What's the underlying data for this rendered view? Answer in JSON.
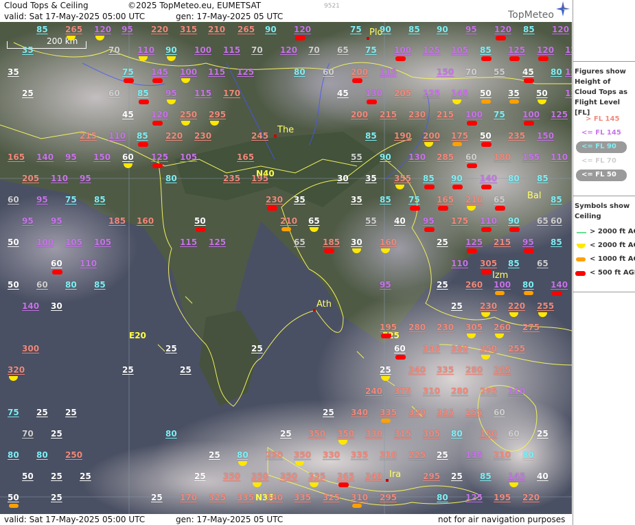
{
  "header": {
    "title": "Cloud Tops & Ceiling",
    "copyright": "©2025 TopMeteo.eu, EUMETSAT",
    "image_number": "9521",
    "valid": "valid:  Sat  17-May-2025  05:00 UTC",
    "generated": "gen: 17-May-2025 05 UTC",
    "logo": "TopMeteo"
  },
  "footer": {
    "valid": "valid:  Sat  17-May-2025  05:00 UTC",
    "generated": "gen: 17-May-2025 05 UTC",
    "disclaimer": "not for air navigation purposes"
  },
  "legend": {
    "tops_title": "Figures show Height of Cloud Tops as Flight Level  [FL]",
    "tops": [
      {
        "text": "> FL 145",
        "color": "#f08a7c"
      },
      {
        "text": "<= FL 145",
        "color": "#c874ea"
      },
      {
        "text": "<= FL 90",
        "color": "#7ff0f6"
      },
      {
        "text": "<= FL 70",
        "color": "#cfcfcf"
      },
      {
        "text": "<= FL 50",
        "color": "#ffffff"
      }
    ],
    "ceiling_title": "Symbols show Ceiling",
    "ceiling": [
      {
        "text": "> 2000 ft AGL",
        "symbol": "line-green"
      },
      {
        "text": "< 2000 ft AGL",
        "symbol": "half-yellow"
      },
      {
        "text": "< 1000 ft AGL",
        "symbol": "bar-orange"
      },
      {
        "text": "< 500 ft AGL",
        "symbol": "bar-red"
      }
    ]
  },
  "map": {
    "scale": "200 km",
    "cities": [
      {
        "name": "Plo"
      },
      {
        "name": "The"
      },
      {
        "name": "Ath"
      },
      {
        "name": "Izm"
      },
      {
        "name": "Bal"
      },
      {
        "name": "Ira"
      }
    ],
    "grid": [
      "N40",
      "E20",
      "E25",
      "N35"
    ]
  },
  "observations": [
    {
      "v": "85",
      "c": "c",
      "s": ""
    },
    {
      "v": "265",
      "c": "r",
      "s": "y"
    },
    {
      "v": "120",
      "c": "v",
      "s": "y"
    },
    {
      "v": "95",
      "c": "v",
      "s": ""
    },
    {
      "v": "220",
      "c": "r",
      "s": ""
    },
    {
      "v": "315",
      "c": "r",
      "s": ""
    },
    {
      "v": "210",
      "c": "r",
      "s": ""
    },
    {
      "v": "265",
      "c": "r",
      "s": ""
    },
    {
      "v": "90",
      "c": "c",
      "s": ""
    },
    {
      "v": "120",
      "c": "v",
      "s": "d"
    },
    {
      "v": "75",
      "c": "c",
      "s": ""
    },
    {
      "v": "90",
      "c": "c",
      "s": ""
    },
    {
      "v": "85",
      "c": "c",
      "s": ""
    },
    {
      "v": "90",
      "c": "c",
      "s": ""
    },
    {
      "v": "95",
      "c": "v",
      "s": ""
    },
    {
      "v": "120",
      "c": "v",
      "s": "d"
    },
    {
      "v": "85",
      "c": "c",
      "s": ""
    },
    {
      "v": "120",
      "c": "v",
      "s": ""
    },
    {
      "v": "35",
      "c": "c",
      "s": ""
    },
    {
      "v": "70",
      "c": "g",
      "s": ""
    },
    {
      "v": "110",
      "c": "v",
      "s": "y"
    },
    {
      "v": "90",
      "c": "c",
      "s": "y"
    },
    {
      "v": "100",
      "c": "v",
      "s": ""
    },
    {
      "v": "115",
      "c": "v",
      "s": ""
    },
    {
      "v": "70",
      "c": "g",
      "s": ""
    },
    {
      "v": "120",
      "c": "v",
      "s": ""
    },
    {
      "v": "70",
      "c": "g",
      "s": ""
    },
    {
      "v": "65",
      "c": "g",
      "s": ""
    },
    {
      "v": "75",
      "c": "c",
      "s": ""
    },
    {
      "v": "100",
      "c": "v",
      "s": "d"
    },
    {
      "v": "125",
      "c": "v",
      "s": ""
    },
    {
      "v": "105",
      "c": "v",
      "s": ""
    },
    {
      "v": "85",
      "c": "c",
      "s": "d"
    },
    {
      "v": "125",
      "c": "v",
      "s": "d"
    },
    {
      "v": "120",
      "c": "v",
      "s": "d"
    },
    {
      "v": "125",
      "c": "v",
      "s": ""
    },
    {
      "v": "35",
      "c": "w",
      "s": ""
    },
    {
      "v": "75",
      "c": "c",
      "s": "d"
    },
    {
      "v": "145",
      "c": "v",
      "s": "d"
    },
    {
      "v": "100",
      "c": "v",
      "s": "y"
    },
    {
      "v": "115",
      "c": "v",
      "s": ""
    },
    {
      "v": "125",
      "c": "v",
      "s": ""
    },
    {
      "v": "80",
      "c": "c",
      "s": ""
    },
    {
      "v": "60",
      "c": "g",
      "s": ""
    },
    {
      "v": "200",
      "c": "r",
      "s": "d"
    },
    {
      "v": "115",
      "c": "v",
      "s": ""
    },
    {
      "v": "150",
      "c": "v",
      "s": ""
    },
    {
      "v": "70",
      "c": "g",
      "s": ""
    },
    {
      "v": "55",
      "c": "g",
      "s": ""
    },
    {
      "v": "45",
      "c": "w",
      "s": "d"
    },
    {
      "v": "80",
      "c": "c",
      "s": ""
    },
    {
      "v": "120",
      "c": "v",
      "s": ""
    },
    {
      "v": "25",
      "c": "w",
      "s": ""
    },
    {
      "v": "60",
      "c": "g",
      "s": ""
    },
    {
      "v": "85",
      "c": "c",
      "s": "d"
    },
    {
      "v": "95",
      "c": "v",
      "s": "y"
    },
    {
      "v": "115",
      "c": "v",
      "s": ""
    },
    {
      "v": "170",
      "c": "r",
      "s": ""
    },
    {
      "v": "45",
      "c": "w",
      "s": ""
    },
    {
      "v": "130",
      "c": "v",
      "s": "d"
    },
    {
      "v": "205",
      "c": "r",
      "s": ""
    },
    {
      "v": "125",
      "c": "v",
      "s": ""
    },
    {
      "v": "145",
      "c": "v",
      "s": "y"
    },
    {
      "v": "50",
      "c": "w",
      "s": "o"
    },
    {
      "v": "35",
      "c": "w",
      "s": "o"
    },
    {
      "v": "50",
      "c": "w",
      "s": "y"
    },
    {
      "v": "120",
      "c": "v",
      "s": ""
    },
    {
      "v": "45",
      "c": "w",
      "s": ""
    },
    {
      "v": "120",
      "c": "v",
      "s": "d"
    },
    {
      "v": "250",
      "c": "r",
      "s": "y"
    },
    {
      "v": "295",
      "c": "r",
      "s": "y"
    },
    {
      "v": "200",
      "c": "r",
      "s": ""
    },
    {
      "v": "215",
      "c": "r",
      "s": ""
    },
    {
      "v": "230",
      "c": "r",
      "s": ""
    },
    {
      "v": "215",
      "c": "r",
      "s": ""
    },
    {
      "v": "100",
      "c": "v",
      "s": "d"
    },
    {
      "v": "75",
      "c": "c",
      "s": ""
    },
    {
      "v": "100",
      "c": "v",
      "s": "d"
    },
    {
      "v": "125",
      "c": "v",
      "s": ""
    },
    {
      "v": "215",
      "c": "r",
      "s": ""
    },
    {
      "v": "110",
      "c": "v",
      "s": ""
    },
    {
      "v": "85",
      "c": "c",
      "s": "d"
    },
    {
      "v": "220",
      "c": "r",
      "s": ""
    },
    {
      "v": "230",
      "c": "r",
      "s": ""
    },
    {
      "v": "245",
      "c": "r",
      "s": ""
    },
    {
      "v": "85",
      "c": "c",
      "s": ""
    },
    {
      "v": "190",
      "c": "r",
      "s": ""
    },
    {
      "v": "200",
      "c": "r",
      "s": "y"
    },
    {
      "v": "175",
      "c": "r",
      "s": "o"
    },
    {
      "v": "50",
      "c": "w",
      "s": "d"
    },
    {
      "v": "235",
      "c": "r",
      "s": ""
    },
    {
      "v": "150",
      "c": "v",
      "s": ""
    },
    {
      "v": "165",
      "c": "r",
      "s": ""
    },
    {
      "v": "140",
      "c": "v",
      "s": ""
    },
    {
      "v": "95",
      "c": "v",
      "s": ""
    },
    {
      "v": "150",
      "c": "v",
      "s": ""
    },
    {
      "v": "60",
      "c": "w",
      "s": "y"
    },
    {
      "v": "125",
      "c": "v",
      "s": "d"
    },
    {
      "v": "105",
      "c": "v",
      "s": ""
    },
    {
      "v": "165",
      "c": "r",
      "s": ""
    },
    {
      "v": "55",
      "c": "g",
      "s": ""
    },
    {
      "v": "90",
      "c": "c",
      "s": ""
    },
    {
      "v": "130",
      "c": "v",
      "s": ""
    },
    {
      "v": "285",
      "c": "r",
      "s": ""
    },
    {
      "v": "60",
      "c": "g",
      "s": "d"
    },
    {
      "v": "180",
      "c": "r",
      "s": ""
    },
    {
      "v": "155",
      "c": "v",
      "s": ""
    },
    {
      "v": "110",
      "c": "v",
      "s": ""
    },
    {
      "v": "205",
      "c": "r",
      "s": ""
    },
    {
      "v": "110",
      "c": "v",
      "s": ""
    },
    {
      "v": "95",
      "c": "v",
      "s": ""
    },
    {
      "v": "80",
      "c": "c",
      "s": ""
    },
    {
      "v": "235",
      "c": "r",
      "s": ""
    },
    {
      "v": "195",
      "c": "r",
      "s": ""
    },
    {
      "v": "30",
      "c": "w",
      "s": ""
    },
    {
      "v": "35",
      "c": "w",
      "s": ""
    },
    {
      "v": "355",
      "c": "r",
      "s": "y"
    },
    {
      "v": "85",
      "c": "c",
      "s": "d"
    },
    {
      "v": "90",
      "c": "c",
      "s": "d"
    },
    {
      "v": "140",
      "c": "v",
      "s": "d"
    },
    {
      "v": "80",
      "c": "c",
      "s": ""
    },
    {
      "v": "85",
      "c": "c",
      "s": ""
    },
    {
      "v": "60",
      "c": "g",
      "s": ""
    },
    {
      "v": "95",
      "c": "v",
      "s": ""
    },
    {
      "v": "75",
      "c": "c",
      "s": ""
    },
    {
      "v": "85",
      "c": "c",
      "s": ""
    },
    {
      "v": "230",
      "c": "r",
      "s": "d"
    },
    {
      "v": "35",
      "c": "w",
      "s": ""
    },
    {
      "v": "35",
      "c": "w",
      "s": ""
    },
    {
      "v": "85",
      "c": "c",
      "s": ""
    },
    {
      "v": "75",
      "c": "c",
      "s": "d"
    },
    {
      "v": "165",
      "c": "r",
      "s": "d"
    },
    {
      "v": "210",
      "c": "r",
      "s": "y"
    },
    {
      "v": "65",
      "c": "g",
      "s": "d"
    },
    {
      "v": "85",
      "c": "c",
      "s": ""
    },
    {
      "v": "95",
      "c": "v",
      "s": ""
    },
    {
      "v": "95",
      "c": "v",
      "s": ""
    },
    {
      "v": "185",
      "c": "r",
      "s": ""
    },
    {
      "v": "160",
      "c": "r",
      "s": ""
    },
    {
      "v": "50",
      "c": "w",
      "s": "d"
    },
    {
      "v": "210",
      "c": "r",
      "s": "o"
    },
    {
      "v": "65",
      "c": "w",
      "s": "y"
    },
    {
      "v": "55",
      "c": "g",
      "s": ""
    },
    {
      "v": "40",
      "c": "w",
      "s": ""
    },
    {
      "v": "95",
      "c": "v",
      "s": "d"
    },
    {
      "v": "175",
      "c": "r",
      "s": ""
    },
    {
      "v": "110",
      "c": "v",
      "s": "d"
    },
    {
      "v": "90",
      "c": "c",
      "s": "d"
    },
    {
      "v": "65",
      "c": "g",
      "s": ""
    },
    {
      "v": "60",
      "c": "g",
      "s": ""
    },
    {
      "v": "50",
      "c": "w",
      "s": ""
    },
    {
      "v": "100",
      "c": "v",
      "s": ""
    },
    {
      "v": "105",
      "c": "v",
      "s": ""
    },
    {
      "v": "105",
      "c": "v",
      "s": ""
    },
    {
      "v": "115",
      "c": "v",
      "s": ""
    },
    {
      "v": "125",
      "c": "v",
      "s": ""
    },
    {
      "v": "65",
      "c": "g",
      "s": ""
    },
    {
      "v": "185",
      "c": "r",
      "s": "d"
    },
    {
      "v": "30",
      "c": "w",
      "s": "y"
    },
    {
      "v": "160",
      "c": "r",
      "s": "y"
    },
    {
      "v": "25",
      "c": "w",
      "s": ""
    },
    {
      "v": "125",
      "c": "v",
      "s": "d"
    },
    {
      "v": "215",
      "c": "r",
      "s": ""
    },
    {
      "v": "95",
      "c": "v",
      "s": "d"
    },
    {
      "v": "85",
      "c": "c",
      "s": ""
    },
    {
      "v": "60",
      "c": "w",
      "s": "d"
    },
    {
      "v": "110",
      "c": "v",
      "s": ""
    },
    {
      "v": "110",
      "c": "v",
      "s": ""
    },
    {
      "v": "305",
      "c": "r",
      "s": "d"
    },
    {
      "v": "85",
      "c": "c",
      "s": ""
    },
    {
      "v": "65",
      "c": "g",
      "s": ""
    },
    {
      "v": "50",
      "c": "w",
      "s": ""
    },
    {
      "v": "60",
      "c": "g",
      "s": ""
    },
    {
      "v": "80",
      "c": "c",
      "s": ""
    },
    {
      "v": "85",
      "c": "c",
      "s": ""
    },
    {
      "v": "95",
      "c": "v",
      "s": ""
    },
    {
      "v": "25",
      "c": "w",
      "s": ""
    },
    {
      "v": "260",
      "c": "r",
      "s": ""
    },
    {
      "v": "100",
      "c": "v",
      "s": "o"
    },
    {
      "v": "80",
      "c": "c",
      "s": "o"
    },
    {
      "v": "140",
      "c": "v",
      "s": "d"
    },
    {
      "v": "140",
      "c": "v",
      "s": ""
    },
    {
      "v": "30",
      "c": "w",
      "s": ""
    },
    {
      "v": "25",
      "c": "w",
      "s": ""
    },
    {
      "v": "230",
      "c": "r",
      "s": "y"
    },
    {
      "v": "220",
      "c": "r",
      "s": "y"
    },
    {
      "v": "255",
      "c": "r",
      "s": "y"
    },
    {
      "v": "195",
      "c": "r",
      "s": "d"
    },
    {
      "v": "280",
      "c": "r",
      "s": ""
    },
    {
      "v": "230",
      "c": "r",
      "s": ""
    },
    {
      "v": "305",
      "c": "r",
      "s": "y"
    },
    {
      "v": "260",
      "c": "r",
      "s": "y"
    },
    {
      "v": "275",
      "c": "r",
      "s": ""
    },
    {
      "v": "300",
      "c": "r",
      "s": ""
    },
    {
      "v": "25",
      "c": "w",
      "s": ""
    },
    {
      "v": "25",
      "c": "w",
      "s": ""
    },
    {
      "v": "60",
      "c": "w",
      "s": "d"
    },
    {
      "v": "345",
      "c": "r",
      "s": ""
    },
    {
      "v": "330",
      "c": "r",
      "s": ""
    },
    {
      "v": "350",
      "c": "r",
      "s": "y"
    },
    {
      "v": "255",
      "c": "r",
      "s": ""
    },
    {
      "v": "320",
      "c": "r",
      "s": "y"
    },
    {
      "v": "25",
      "c": "w",
      "s": ""
    },
    {
      "v": "25",
      "c": "w",
      "s": ""
    },
    {
      "v": "25",
      "c": "w",
      "s": "y"
    },
    {
      "v": "340",
      "c": "r",
      "s": ""
    },
    {
      "v": "335",
      "c": "r",
      "s": ""
    },
    {
      "v": "280",
      "c": "r",
      "s": ""
    },
    {
      "v": "285",
      "c": "r",
      "s": ""
    },
    {
      "v": "240",
      "c": "r",
      "s": ""
    },
    {
      "v": "375",
      "c": "r",
      "s": ""
    },
    {
      "v": "310",
      "c": "r",
      "s": ""
    },
    {
      "v": "280",
      "c": "r",
      "s": ""
    },
    {
      "v": "295",
      "c": "r",
      "s": ""
    },
    {
      "v": "110",
      "c": "v",
      "s": ""
    },
    {
      "v": "75",
      "c": "c",
      "s": ""
    },
    {
      "v": "25",
      "c": "w",
      "s": ""
    },
    {
      "v": "25",
      "c": "w",
      "s": ""
    },
    {
      "v": "25",
      "c": "w",
      "s": ""
    },
    {
      "v": "340",
      "c": "r",
      "s": ""
    },
    {
      "v": "335",
      "c": "r",
      "s": "o"
    },
    {
      "v": "330",
      "c": "r",
      "s": ""
    },
    {
      "v": "335",
      "c": "r",
      "s": ""
    },
    {
      "v": "255",
      "c": "r",
      "s": ""
    },
    {
      "v": "60",
      "c": "g",
      "s": ""
    },
    {
      "v": "70",
      "c": "g",
      "s": ""
    },
    {
      "v": "25",
      "c": "w",
      "s": ""
    },
    {
      "v": "80",
      "c": "c",
      "s": ""
    },
    {
      "v": "25",
      "c": "w",
      "s": ""
    },
    {
      "v": "350",
      "c": "r",
      "s": ""
    },
    {
      "v": "350",
      "c": "r",
      "s": "y"
    },
    {
      "v": "330",
      "c": "r",
      "s": ""
    },
    {
      "v": "315",
      "c": "r",
      "s": ""
    },
    {
      "v": "305",
      "c": "r",
      "s": ""
    },
    {
      "v": "80",
      "c": "c",
      "s": ""
    },
    {
      "v": "150",
      "c": "r",
      "s": ""
    },
    {
      "v": "60",
      "c": "g",
      "s": ""
    },
    {
      "v": "25",
      "c": "w",
      "s": ""
    },
    {
      "v": "80",
      "c": "c",
      "s": ""
    },
    {
      "v": "80",
      "c": "c",
      "s": ""
    },
    {
      "v": "250",
      "c": "r",
      "s": ""
    },
    {
      "v": "25",
      "c": "w",
      "s": ""
    },
    {
      "v": "80",
      "c": "c",
      "s": "y"
    },
    {
      "v": "230",
      "c": "r",
      "s": ""
    },
    {
      "v": "350",
      "c": "r",
      "s": "y"
    },
    {
      "v": "330",
      "c": "r",
      "s": ""
    },
    {
      "v": "335",
      "c": "r",
      "s": ""
    },
    {
      "v": "310",
      "c": "r",
      "s": ""
    },
    {
      "v": "225",
      "c": "r",
      "s": ""
    },
    {
      "v": "25",
      "c": "w",
      "s": ""
    },
    {
      "v": "135",
      "c": "v",
      "s": ""
    },
    {
      "v": "210",
      "c": "r",
      "s": ""
    },
    {
      "v": "80",
      "c": "c",
      "s": ""
    },
    {
      "v": "50",
      "c": "w",
      "s": ""
    },
    {
      "v": "25",
      "c": "w",
      "s": ""
    },
    {
      "v": "25",
      "c": "w",
      "s": ""
    },
    {
      "v": "25",
      "c": "w",
      "s": ""
    },
    {
      "v": "350",
      "c": "r",
      "s": ""
    },
    {
      "v": "350",
      "c": "r",
      "s": "y"
    },
    {
      "v": "350",
      "c": "r",
      "s": ""
    },
    {
      "v": "335",
      "c": "r",
      "s": "y"
    },
    {
      "v": "365",
      "c": "r",
      "s": "d"
    },
    {
      "v": "340",
      "c": "r",
      "s": ""
    },
    {
      "v": "295",
      "c": "r",
      "s": ""
    },
    {
      "v": "25",
      "c": "w",
      "s": ""
    },
    {
      "v": "85",
      "c": "c",
      "s": ""
    },
    {
      "v": "145",
      "c": "v",
      "s": "y"
    },
    {
      "v": "40",
      "c": "w",
      "s": ""
    },
    {
      "v": "50",
      "c": "w",
      "s": "o"
    },
    {
      "v": "25",
      "c": "w",
      "s": ""
    },
    {
      "v": "25",
      "c": "w",
      "s": ""
    },
    {
      "v": "170",
      "c": "r",
      "s": ""
    },
    {
      "v": "325",
      "c": "r",
      "s": ""
    },
    {
      "v": "335",
      "c": "r",
      "s": ""
    },
    {
      "v": "340",
      "c": "r",
      "s": ""
    },
    {
      "v": "335",
      "c": "r",
      "s": ""
    },
    {
      "v": "325",
      "c": "r",
      "s": ""
    },
    {
      "v": "310",
      "c": "r",
      "s": "o"
    },
    {
      "v": "295",
      "c": "r",
      "s": ""
    },
    {
      "v": "80",
      "c": "c",
      "s": ""
    },
    {
      "v": "125",
      "c": "v",
      "s": ""
    },
    {
      "v": "195",
      "c": "r",
      "s": ""
    },
    {
      "v": "220",
      "c": "r",
      "s": ""
    },
    {
      "v": "40",
      "c": "w",
      "s": "d"
    }
  ]
}
